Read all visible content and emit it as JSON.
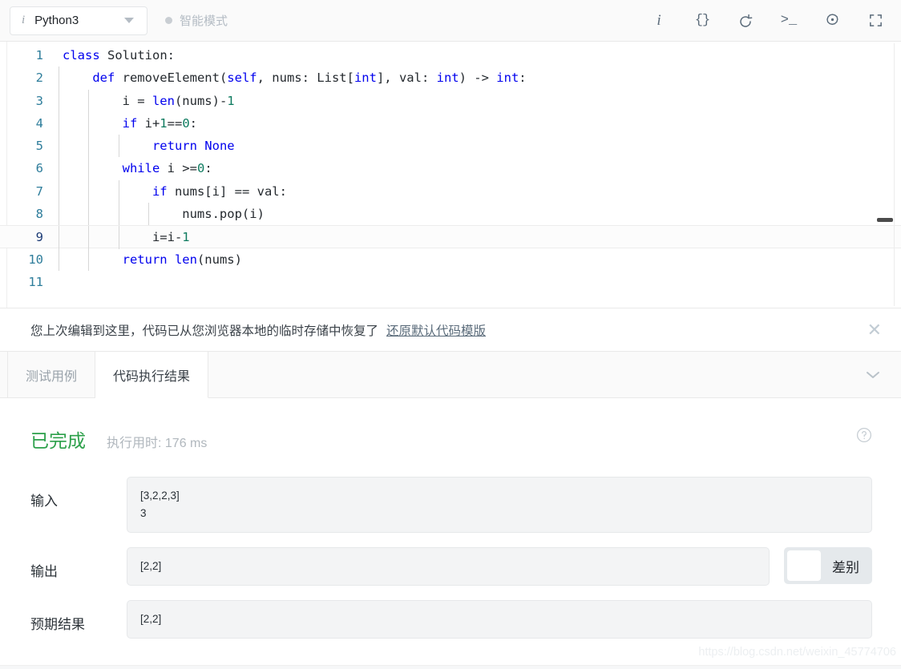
{
  "toolbar": {
    "language": "Python3",
    "language_icon": "info-italic-icon",
    "smart_mode": "智能模式",
    "icons": [
      {
        "name": "info-icon",
        "glyph": "i"
      },
      {
        "name": "format-braces-icon",
        "glyph": "{}"
      },
      {
        "name": "reset-code-icon",
        "glyph": "reset"
      },
      {
        "name": "console-icon",
        "glyph": ">_"
      },
      {
        "name": "settings-gear-icon",
        "glyph": "gear"
      },
      {
        "name": "fullscreen-icon",
        "glyph": "expand"
      }
    ]
  },
  "editor": {
    "lines": [
      {
        "n": "1",
        "indent": 0,
        "guides": 0,
        "tokens": [
          {
            "t": "class",
            "c": "kw"
          },
          {
            "t": " Solution:",
            "c": "def"
          }
        ]
      },
      {
        "n": "2",
        "indent": 4,
        "guides": 1,
        "tokens": [
          {
            "t": "def",
            "c": "kw"
          },
          {
            "t": " removeElement(",
            "c": "def"
          },
          {
            "t": "self",
            "c": "kw2"
          },
          {
            "t": ", nums: List[",
            "c": "def"
          },
          {
            "t": "int",
            "c": "kw2"
          },
          {
            "t": "], val: ",
            "c": "def"
          },
          {
            "t": "int",
            "c": "kw2"
          },
          {
            "t": ") -> ",
            "c": "def"
          },
          {
            "t": "int",
            "c": "kw2"
          },
          {
            "t": ":",
            "c": "def"
          }
        ]
      },
      {
        "n": "3",
        "indent": 8,
        "guides": 2,
        "tokens": [
          {
            "t": "i = ",
            "c": "def"
          },
          {
            "t": "len",
            "c": "fn"
          },
          {
            "t": "(nums)-",
            "c": "def"
          },
          {
            "t": "1",
            "c": "num"
          }
        ]
      },
      {
        "n": "4",
        "indent": 8,
        "guides": 2,
        "tokens": [
          {
            "t": "if",
            "c": "kw"
          },
          {
            "t": " i+",
            "c": "def"
          },
          {
            "t": "1",
            "c": "num"
          },
          {
            "t": "==",
            "c": "def"
          },
          {
            "t": "0",
            "c": "num"
          },
          {
            "t": ":",
            "c": "def"
          }
        ]
      },
      {
        "n": "5",
        "indent": 12,
        "guides": 3,
        "tokens": [
          {
            "t": "return",
            "c": "kw"
          },
          {
            "t": " ",
            "c": "def"
          },
          {
            "t": "None",
            "c": "kw2"
          }
        ]
      },
      {
        "n": "6",
        "indent": 8,
        "guides": 2,
        "tokens": [
          {
            "t": "while",
            "c": "kw"
          },
          {
            "t": " i >=",
            "c": "def"
          },
          {
            "t": "0",
            "c": "num"
          },
          {
            "t": ":",
            "c": "def"
          }
        ]
      },
      {
        "n": "7",
        "indent": 12,
        "guides": 3,
        "tokens": [
          {
            "t": "if",
            "c": "kw"
          },
          {
            "t": " nums[i] == val:",
            "c": "def"
          }
        ]
      },
      {
        "n": "8",
        "indent": 16,
        "guides": 4,
        "tokens": [
          {
            "t": "nums.pop(i)",
            "c": "def"
          }
        ]
      },
      {
        "n": "9",
        "indent": 12,
        "guides": 3,
        "active": true,
        "tokens": [
          {
            "t": "i=i-",
            "c": "def"
          },
          {
            "t": "1",
            "c": "num"
          }
        ]
      },
      {
        "n": "10",
        "indent": 8,
        "guides": 2,
        "tokens": [
          {
            "t": "return",
            "c": "kw"
          },
          {
            "t": " ",
            "c": "def"
          },
          {
            "t": "len",
            "c": "fn"
          },
          {
            "t": "(nums)",
            "c": "def"
          }
        ]
      },
      {
        "n": "11",
        "indent": 0,
        "guides": 0,
        "tokens": []
      }
    ]
  },
  "notice": {
    "text": "您上次编辑到这里，代码已从您浏览器本地的临时存储中恢复了",
    "link": "还原默认代码模版",
    "close_icon": "close-icon"
  },
  "tabs": [
    {
      "label": "测试用例",
      "active": false
    },
    {
      "label": "代码执行结果",
      "active": true
    }
  ],
  "result": {
    "status": "已完成",
    "status_color": "#2ca04a",
    "runtime": "执行用时: 176 ms",
    "help_icon": "help-circle-icon",
    "fields": [
      {
        "label": "输入",
        "values": [
          "[3,2,2,3]",
          "3"
        ]
      },
      {
        "label": "输出",
        "values": [
          "[2,2]"
        ]
      },
      {
        "label": "预期结果",
        "values": [
          "[2,2]"
        ]
      }
    ],
    "diff_label": "差别"
  },
  "watermark": "https://blog.csdn.net/weixin_45774706"
}
